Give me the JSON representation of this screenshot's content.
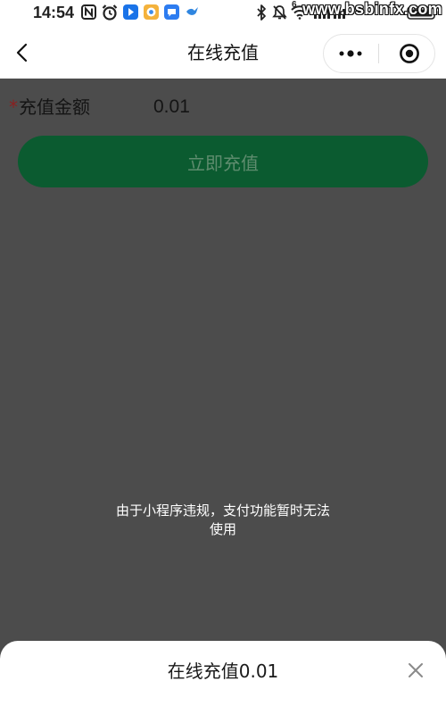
{
  "status_bar": {
    "time": "14:54",
    "wifi_label": "6",
    "left_icons": [
      "nfc-icon",
      "alarm-icon",
      "app-icon-blue",
      "app-icon-orange",
      "app-icon-chat",
      "app-icon-bird"
    ],
    "right_icons": [
      "bluetooth-icon",
      "bell-mute-icon",
      "wifi-icon",
      "signal-icon",
      "battery-icon"
    ]
  },
  "watermark": "www.bsbinfx.com",
  "nav": {
    "title": "在线充值",
    "icons": [
      "chevron-left-icon",
      "more-dots-icon",
      "target-circle-icon"
    ]
  },
  "form": {
    "required_mark": "*",
    "amount_label": "充值金额",
    "amount_value": "0.01",
    "submit_label": "立即充值"
  },
  "toast": {
    "message": "由于小程序违规，支付功能暂时无法\n使用"
  },
  "sheet": {
    "title": "在线充值0.01",
    "close_icon": "close-icon"
  },
  "colors": {
    "mask": "#4c4c4c",
    "button_green": "#0b5b30",
    "button_text": "#5e8c6e",
    "required_red": "#8a2020"
  }
}
